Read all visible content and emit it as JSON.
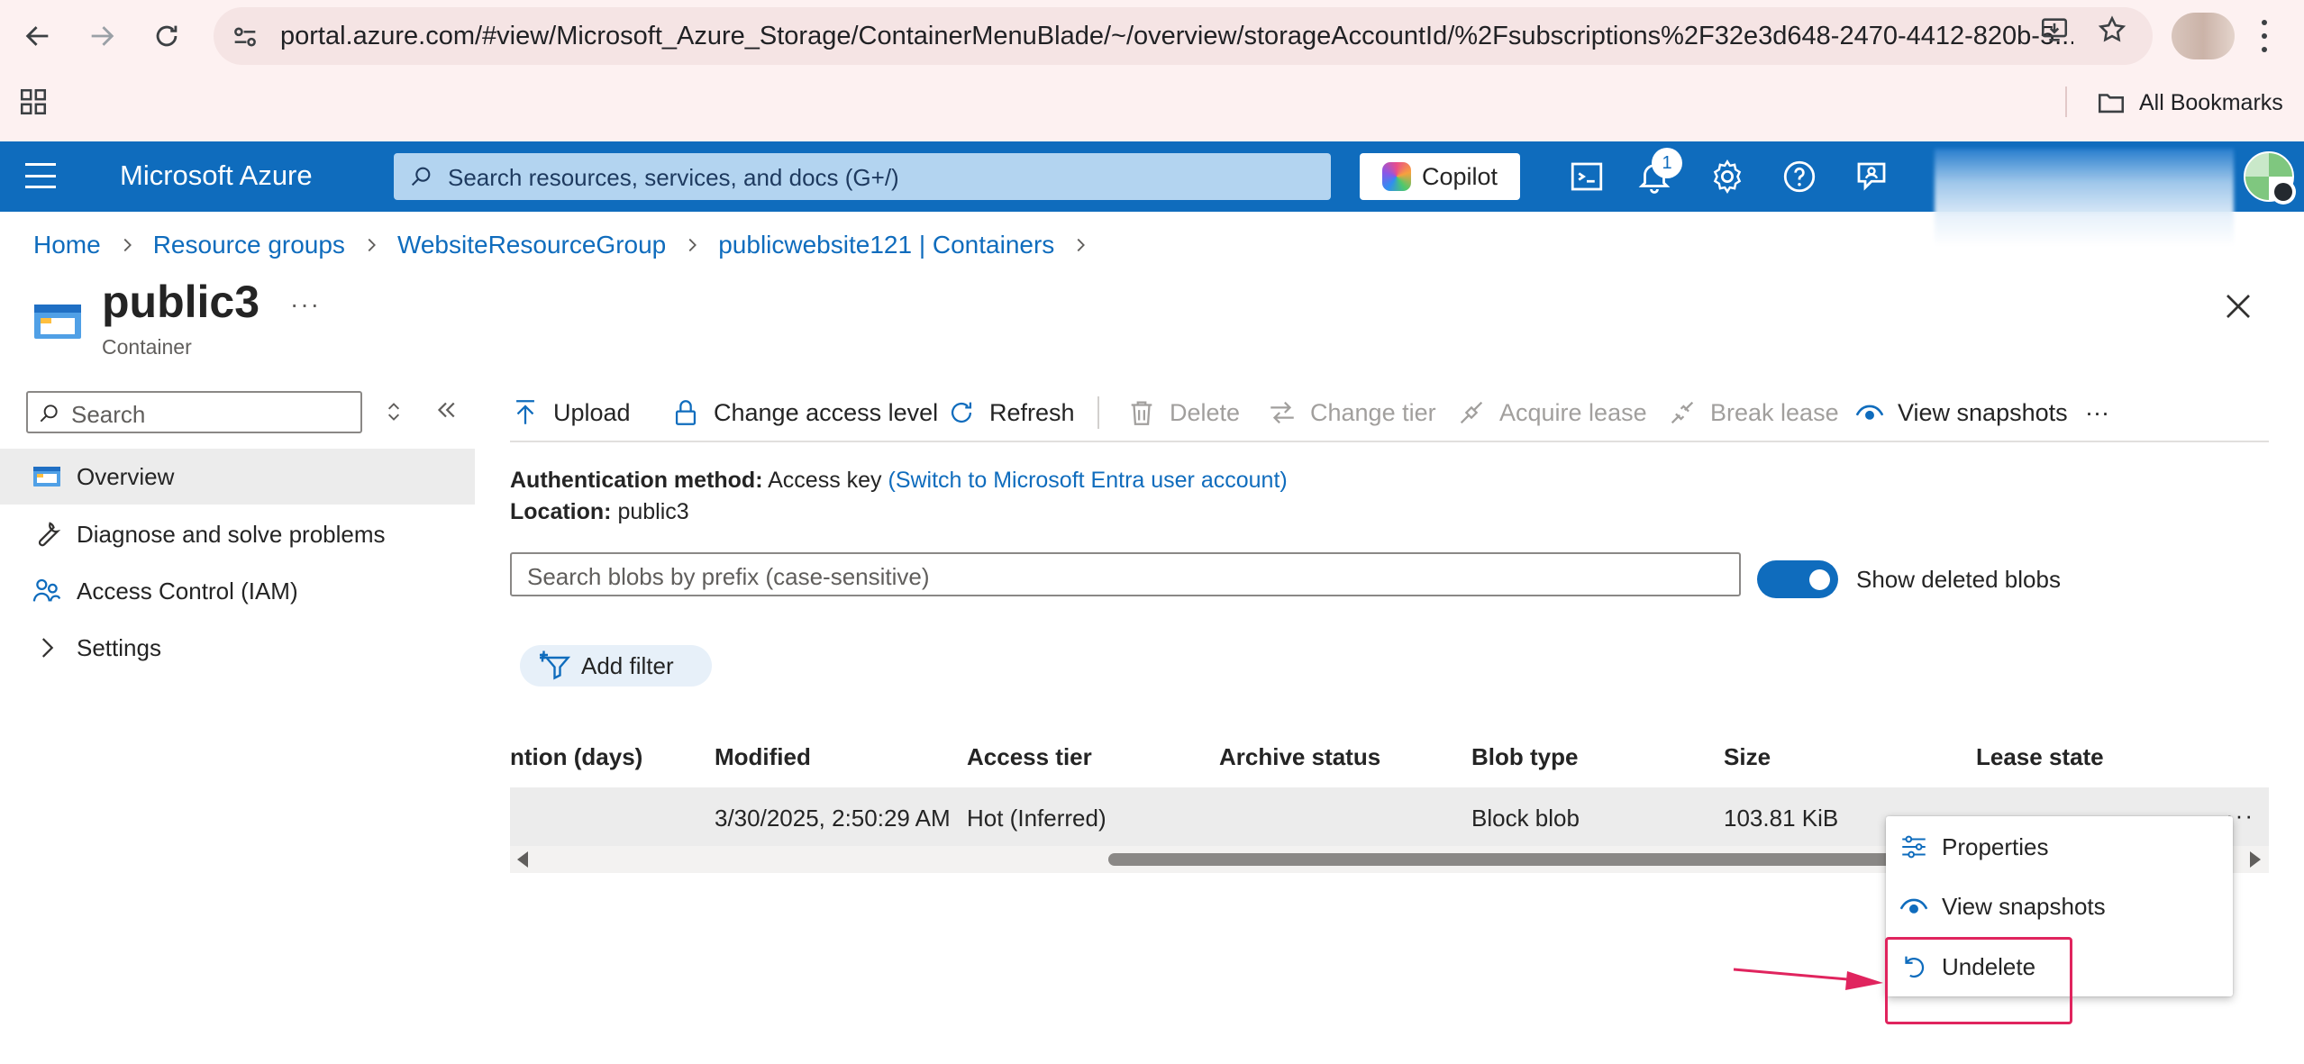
{
  "browser": {
    "url": "portal.azure.com/#view/Microsoft_Azure_Storage/ContainerMenuBlade/~/overview/storageAccountId/%2Fsubscriptions%2F32e3d648-2470-4412-820b-5...",
    "bookmarks_label": "All Bookmarks"
  },
  "azure": {
    "brand": "Microsoft Azure",
    "search_placeholder": "Search resources, services, and docs (G+/)",
    "copilot_label": "Copilot",
    "notification_count": "1"
  },
  "breadcrumb": [
    "Home",
    "Resource groups",
    "WebsiteResourceGroup",
    "publicwebsite121 | Containers"
  ],
  "page": {
    "title": "public3",
    "title_more": "···",
    "subtitle": "Container"
  },
  "sidebar": {
    "search_placeholder": "Search",
    "items": [
      {
        "label": "Overview"
      },
      {
        "label": "Diagnose and solve problems"
      },
      {
        "label": "Access Control (IAM)"
      },
      {
        "label": "Settings"
      }
    ]
  },
  "toolbar": {
    "upload": "Upload",
    "change_access": "Change access level",
    "refresh": "Refresh",
    "delete": "Delete",
    "change_tier": "Change tier",
    "acquire_lease": "Acquire lease",
    "break_lease": "Break lease",
    "view_snapshots": "View snapshots",
    "more": "···"
  },
  "info": {
    "auth_label": "Authentication method:",
    "auth_value": "Access key",
    "auth_link": "(Switch to Microsoft Entra user account)",
    "location_label": "Location:",
    "location_value": "public3"
  },
  "blob_search": {
    "placeholder": "Search blobs by prefix (case-sensitive)"
  },
  "show_deleted": {
    "label": "Show deleted blobs",
    "on": true
  },
  "add_filter": "Add filter",
  "table": {
    "columns": [
      "ntion (days)",
      "Modified",
      "Access tier",
      "Archive status",
      "Blob type",
      "Size",
      "Lease state"
    ],
    "row": {
      "modified": "3/30/2025, 2:50:29 AM",
      "access_tier": "Hot (Inferred)",
      "blob_type": "Block blob",
      "size": "103.81 KiB",
      "more": "···"
    }
  },
  "context_menu": {
    "items": [
      "Properties",
      "View snapshots",
      "Undelete"
    ]
  },
  "colors": {
    "azure_blue": "#0f6cbd",
    "highlight": "#e0245e"
  }
}
